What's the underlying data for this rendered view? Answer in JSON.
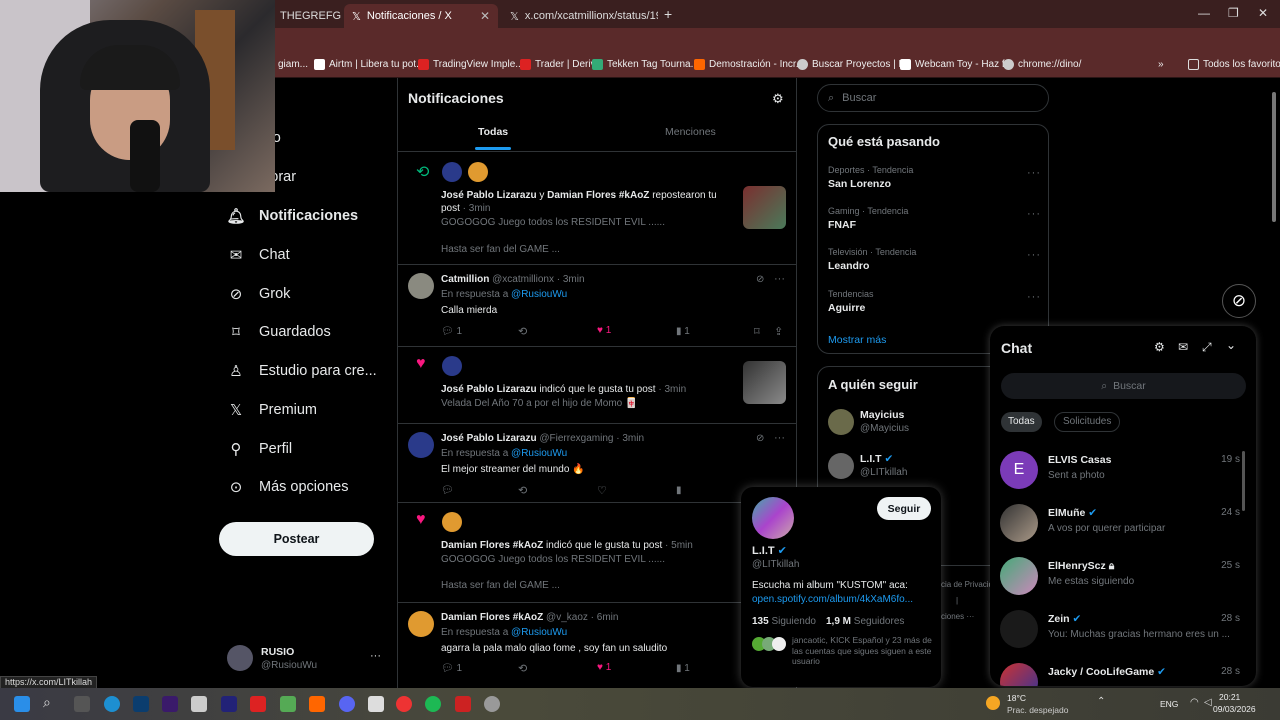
{
  "browser": {
    "tabs": [
      {
        "label": "THEGREFG"
      },
      {
        "label": "Notificaciones / X"
      },
      {
        "label": "x.com/xcatmillionx/status/1940"
      }
    ],
    "new_tab": "+",
    "bookmarks": [
      "giam...",
      "Airtm | Libera tu pot...",
      "TradingView Imple...",
      "Trader | Deriv",
      "Tekken Tag Tourna...",
      "Demostración - Incr...",
      "Buscar Proyectos | F...",
      "Webcam Toy - Haz f...",
      "chrome://dino/"
    ],
    "bookmarks_more": "»",
    "all_bookmarks": "Todos los favoritos",
    "status_url": "https://x.com/LITkillah"
  },
  "sidebar": {
    "items": [
      {
        "label": "icio",
        "icon": "home-icon"
      },
      {
        "label": "plorar",
        "icon": "search-icon"
      },
      {
        "label": "Notificaciones",
        "icon": "bell-icon"
      },
      {
        "label": "Chat",
        "icon": "mail-icon"
      },
      {
        "label": "Grok",
        "icon": "grok-icon"
      },
      {
        "label": "Guardados",
        "icon": "bookmark-icon"
      },
      {
        "label": "Estudio para cre...",
        "icon": "studio-icon"
      },
      {
        "label": "Premium",
        "icon": "x-logo-icon"
      },
      {
        "label": "Perfil",
        "icon": "person-icon"
      },
      {
        "label": "Más opciones",
        "icon": "more-circle-icon"
      }
    ],
    "post_button": "Postear",
    "account": {
      "name": "RUSIO",
      "handle": "@RusiouWu",
      "more": "···"
    }
  },
  "main": {
    "title": "Notificaciones",
    "tabs": [
      {
        "label": "Todas"
      },
      {
        "label": "Menciones"
      }
    ],
    "notifications": [
      {
        "who1": "José Pablo Lizarazu",
        "and": " y ",
        "who2": "Damian Flores #kAoZ",
        "action": " repostearon tu post",
        "time": " · 3min",
        "line2": "GOGOGOG Juego todos los RESIDENT EVIL ......",
        "line3": "Hasta ser fan del GAME ..."
      },
      {
        "name": "Catmillion",
        "handle": "@xcatmillionx",
        "time": " · 3min",
        "reply_to_label": "En respuesta a ",
        "reply_to": "@RusiouWu",
        "text": "Calla mierda",
        "replies": "1",
        "likes": "1",
        "views": "1"
      },
      {
        "who": "José Pablo Lizarazu",
        "action": " indicó que le gusta tu post",
        "time": " · 3min",
        "text": "Velada Del Año 70 a por el hijo de Momo 🀄"
      },
      {
        "name": "José Pablo Lizarazu",
        "handle": "@Fierrexgaming",
        "time": " · 3min",
        "reply_to_label": "En respuesta a ",
        "reply_to": "@RusiouWu",
        "text": "El mejor streamer del mundo 🔥"
      },
      {
        "who": "Damian Flores #kAoZ",
        "action": " indicó que le gusta tu post",
        "time": " · 5min",
        "line2": "GOGOGOG Juego todos los RESIDENT EVIL ......",
        "line3": "Hasta ser fan del GAME ..."
      },
      {
        "name": "Damian Flores #kAoZ",
        "handle": "@v_kaoz",
        "time": " · 6min",
        "reply_to_label": "En respuesta a ",
        "reply_to": "@RusiouWu",
        "text": "agarra la pala malo qliao fome , soy fan un saludito",
        "replies": "1",
        "likes": "1",
        "views": "1"
      }
    ]
  },
  "right": {
    "search_placeholder": "Buscar",
    "trends_title": "Qué está pasando",
    "trends": [
      {
        "category": "Deportes · Tendencia",
        "name": "San Lorenzo"
      },
      {
        "category": "Gaming · Tendencia",
        "name": "FNAF"
      },
      {
        "category": "Televisión · Tendencia",
        "name": "Leandro"
      },
      {
        "category": "Tendencias",
        "name": "Aguirre"
      }
    ],
    "show_more": "Mostrar más",
    "who_to_follow_title": "A quién seguir",
    "follow": [
      {
        "name": "Mayicius",
        "handle": "@Mayicius"
      },
      {
        "name": "L.I.T",
        "handle": "@LITkillah"
      }
    ],
    "footer_fragments": [
      "cia de Privacid",
      "|",
      "ciones ···"
    ]
  },
  "hovercard": {
    "follow_button": "Seguir",
    "name": "L.I.T",
    "handle": "@LITkillah",
    "bio": "Escucha mi album \"KUSTOM\" aca:",
    "link": "open.spotify.com/album/4kXaM6fo...",
    "following_count": "135",
    "following_label": " Siguiendo",
    "followers_count": "1,9 M",
    "followers_label": " Seguidores",
    "mutuals": "jancaotic, KICK Español y 23 más de las cuentas que sigues siguen a este usuario"
  },
  "chat": {
    "title": "Chat",
    "search_placeholder": "Buscar",
    "filters": [
      {
        "label": "Todas"
      },
      {
        "label": "Solicitudes"
      }
    ],
    "conversations": [
      {
        "name": "ELVIS Casas",
        "message": "Sent a photo",
        "time": "19 s",
        "initial": "E"
      },
      {
        "name": "ElMuñe",
        "message": "A vos por querer participar",
        "time": "24 s"
      },
      {
        "name": "ElHenryScz",
        "message": "Me estas siguiendo",
        "time": "25 s"
      },
      {
        "name": "Zein",
        "message": "You: Muchas gracias hermano eres un ...",
        "time": "28 s"
      },
      {
        "name": "Jacky / CooLifeGame",
        "message": "",
        "time": "28 s"
      }
    ]
  },
  "taskbar": {
    "weather_temp": "18°C",
    "weather_desc": "Prac. despejado",
    "lang": "ENG",
    "time": "20:21",
    "date": "09/03/2026"
  },
  "colors": {
    "accent": "#1d9bf0",
    "like": "#f91880",
    "repost": "#00ba7c",
    "tab_bg": "#3a1f1f"
  }
}
